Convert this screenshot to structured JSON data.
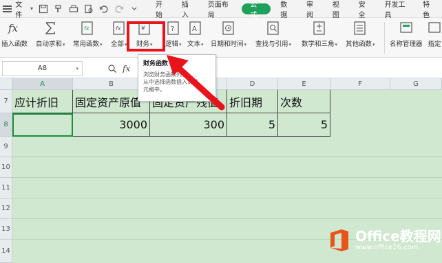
{
  "menubar": {
    "file_label": "文件",
    "tabs": [
      "开始",
      "插入",
      "页面布局",
      "公式",
      "数据",
      "审阅",
      "视图",
      "安全",
      "开发工具",
      "特色"
    ],
    "active_tab": "公式"
  },
  "ribbon": {
    "buttons": [
      {
        "label": "插入函数",
        "caret": ""
      },
      {
        "label": "自动求和",
        "caret": "▾"
      },
      {
        "label": "常用函数",
        "caret": "▾"
      },
      {
        "label": "全部",
        "caret": "▾"
      },
      {
        "label": "财务",
        "caret": "▾"
      },
      {
        "label": "逻辑",
        "caret": "▾"
      },
      {
        "label": "文本",
        "caret": "▾"
      },
      {
        "label": "日期和时间",
        "caret": "▾"
      },
      {
        "label": "查找与引用",
        "caret": "▾"
      },
      {
        "label": "数学和三角",
        "caret": "▾"
      },
      {
        "label": "其他函数",
        "caret": "▾"
      },
      {
        "label": "名称管理器",
        "caret": ""
      },
      {
        "label": "指定",
        "caret": ""
      }
    ],
    "highlight_color": "#e8141b"
  },
  "formula_bar": {
    "name_box": "A8",
    "fx_label": "fx"
  },
  "grid": {
    "columns": [
      "A",
      "B",
      "C",
      "D",
      "E",
      "F",
      "G"
    ],
    "rows": [
      "7",
      "8",
      "9",
      "10",
      "11",
      "12",
      "13",
      "14"
    ],
    "headers": [
      "应计折旧",
      "固定资产原值",
      "固定资产残值",
      "折旧期",
      "次数"
    ],
    "values": [
      "",
      "3000",
      "300",
      "5",
      "5"
    ],
    "selected_cell": "A8",
    "background": "#cfe8cf"
  },
  "tooltip": {
    "title": "财务函数",
    "body": [
      "浏览财务函数列表，",
      "从中选择函数插入到单",
      "元格中。"
    ]
  },
  "watermark": {
    "main": "Office教程网",
    "sub": "www.office26.com"
  },
  "colors": {
    "accent_green": "#1fa15b",
    "arrow_red": "#e8141b",
    "office_orange": "#e8541a"
  }
}
